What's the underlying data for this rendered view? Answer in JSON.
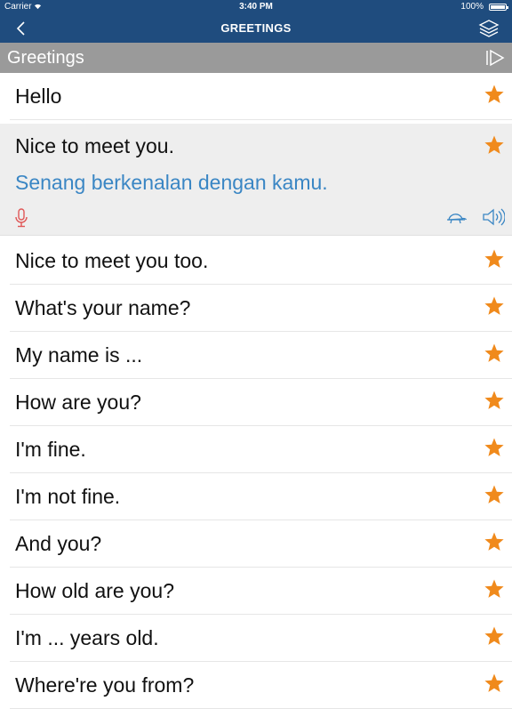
{
  "status_bar": {
    "carrier": "Carrier",
    "time": "3:40 PM",
    "battery": "100%"
  },
  "nav": {
    "title": "GREETINGS",
    "back_icon": "chevron-left-icon",
    "layers_icon": "layers-icon"
  },
  "section": {
    "title": "Greetings",
    "play_icon": "play-icon"
  },
  "colors": {
    "nav_bg": "#1f4c7e",
    "section_bg": "#9a9a9a",
    "star": "#f08a1c",
    "translation": "#3a86c4",
    "mic": "#e05656"
  },
  "phrases": [
    {
      "text": "Hello"
    },
    {
      "text": "Nice to meet you.",
      "translation": "Senang berkenalan dengan kamu.",
      "expanded": true
    },
    {
      "text": "Nice to meet you too."
    },
    {
      "text": "What's your name?"
    },
    {
      "text": "My name is ..."
    },
    {
      "text": "How are you?"
    },
    {
      "text": "I'm fine."
    },
    {
      "text": "I'm not fine."
    },
    {
      "text": "And you?"
    },
    {
      "text": "How old are you?"
    },
    {
      "text": "I'm ... years old."
    },
    {
      "text": "Where're you from?"
    }
  ]
}
